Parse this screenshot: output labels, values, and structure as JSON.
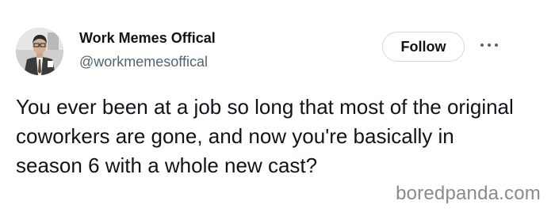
{
  "user": {
    "display_name": "Work Memes Offical",
    "handle": "@workmemesoffical"
  },
  "actions": {
    "follow_label": "Follow",
    "more_icon": "more-horizontal-icon"
  },
  "tweet": {
    "text": "You ever been at a job so long that most of the original coworkers are gone, and now you're basically in season 6 with a whole new cast?"
  },
  "watermark": {
    "text": "boredpanda.com"
  },
  "colors": {
    "text_primary": "#0f1419",
    "text_secondary": "#536471",
    "follow_border": "#cfd9de",
    "watermark": "#8a8a8a"
  }
}
